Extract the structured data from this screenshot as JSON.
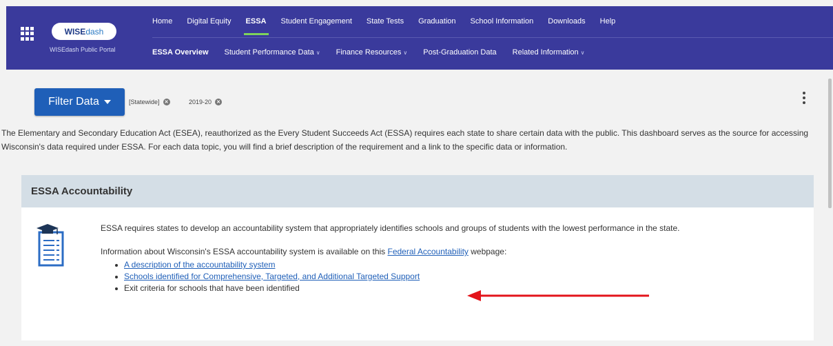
{
  "header": {
    "logo_text_a": "WISE",
    "logo_text_b": "dash",
    "portal_name": "WISEdash Public Portal",
    "top_nav": [
      {
        "label": "Home"
      },
      {
        "label": "Digital Equity"
      },
      {
        "label": "ESSA",
        "active": true
      },
      {
        "label": "Student Engagement"
      },
      {
        "label": "State Tests"
      },
      {
        "label": "Graduation"
      },
      {
        "label": "School Information"
      },
      {
        "label": "Downloads"
      },
      {
        "label": "Help"
      }
    ],
    "sub_nav": [
      {
        "label": "ESSA Overview",
        "active": true
      },
      {
        "label": "Student Performance Data",
        "has_dropdown": true
      },
      {
        "label": "Finance Resources",
        "has_dropdown": true
      },
      {
        "label": "Post-Graduation Data"
      },
      {
        "label": "Related Information",
        "has_dropdown": true
      }
    ],
    "accent_color": "#7ed35a",
    "bg_color": "#3a3a9c"
  },
  "filter": {
    "button_label": "Filter Data",
    "chips": [
      "[Statewide]",
      "2019-20"
    ]
  },
  "intro_text": "The Elementary and Secondary Education Act (ESEA), reauthorized as the Every Student Succeeds Act (ESSA) requires each state to share certain data with the public. This dashboard serves as the source for accessing Wisconsin's data required under ESSA. For each data topic, you will find a brief description of the requirement and a link to the specific data or information.",
  "card": {
    "title": "ESSA Accountability",
    "paragraph1": "ESSA requires states to develop an accountability system that appropriately identifies schools and groups of students with the lowest performance in the state.",
    "paragraph2_pre": "Information about Wisconsin's ESSA accountability system is available on this ",
    "paragraph2_link": "Federal Accountability",
    "paragraph2_post": " webpage:",
    "bullets": [
      {
        "text": "A description of the accountability system",
        "link": true
      },
      {
        "text": "Schools identified for Comprehensive, Targeted, and Additional Targeted Support",
        "link": true
      },
      {
        "text": "Exit criteria for schools that have been identified",
        "link": false
      }
    ]
  },
  "annotation_arrow_color": "#e3141b"
}
